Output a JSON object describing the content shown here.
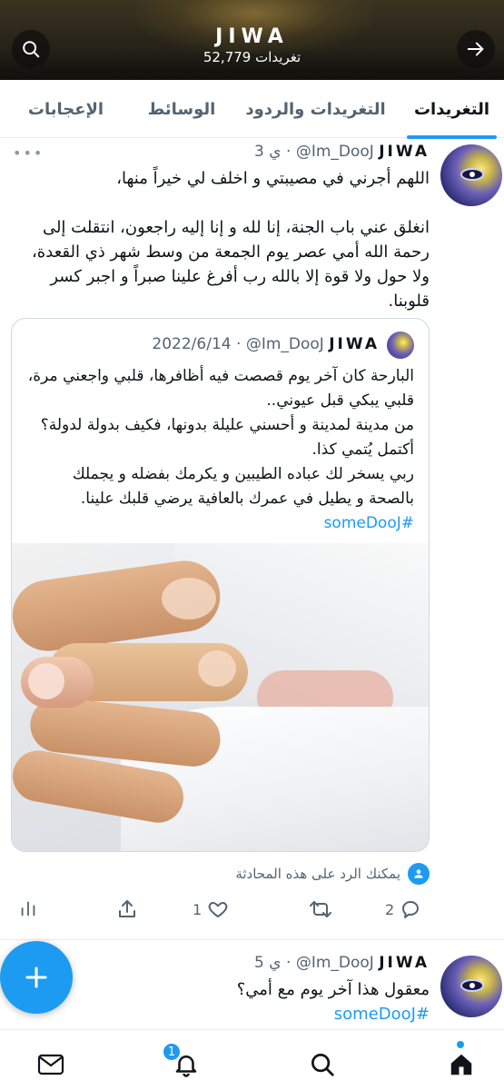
{
  "header": {
    "title": "JIWA",
    "subtitle": "52,779 تغريدات"
  },
  "tabs": [
    {
      "label": "التغريدات",
      "active": true
    },
    {
      "label": "التغريدات والردود",
      "active": false
    },
    {
      "label": "الوسائط",
      "active": false
    },
    {
      "label": "الإعجابات",
      "active": false
    }
  ],
  "tweets": [
    {
      "name": "JIWA",
      "handle": "@Im_DooJ",
      "time": "3 ي",
      "body_lines": [
        "اللهم أجرني في مصيبتي و اخلف لي خيراً منها،",
        "",
        "انغلق عني باب الجنة، إنا لله و إنا إليه راجعون، انتقلت إلى رحمة الله أمي عصر يوم الجمعة من وسط شهر ذي القعدة، ولا حول ولا قوة إلا بالله رب أفرغ علينا صبراً و اجبر كسر قلوبنا."
      ],
      "quote": {
        "name": "JIWA",
        "handle": "@Im_DooJ",
        "date": "2022/6/14",
        "body_lines": [
          "البارحة كان آخر يوم قصصت فيه أظافرها، قلبي واجعني مرة، قلبي يبكي قبل عيوني..",
          "من مدينة لمدينة و أحسني عليلة بدونها، فكيف بدولة لدولة؟ أكتمل يُتمي كذا.",
          "ربي يسخر لك عباده الطيبين و يكرمك بفضله و يجملك بالصحة و يطيل في عمرك بالعافية يرضي قلبك علينا."
        ],
        "hashtag": "#someDooJ"
      },
      "reply_hint": "يمكنك الرد على هذه المحادثة",
      "counts": {
        "replies": "2",
        "retweets": "",
        "likes": "1"
      }
    },
    {
      "name": "JIWA",
      "handle": "@Im_DooJ",
      "time": "5 ي",
      "body_lines": [
        "معقول هذا آخر يوم مع أمي؟"
      ],
      "hashtag": "#someDooJ"
    }
  ],
  "bottom_nav": {
    "notifications_badge": "1"
  },
  "colors": {
    "accent": "#1d9bf0",
    "secondary_text": "#536471",
    "border": "#e6ecf0"
  },
  "icons": [
    "search-icon",
    "arrow-right-icon",
    "more-icon",
    "people-icon",
    "stats-icon",
    "share-icon",
    "heart-icon",
    "retweet-icon",
    "reply-icon",
    "compose-icon",
    "mail-icon",
    "bell-icon",
    "home-icon"
  ]
}
